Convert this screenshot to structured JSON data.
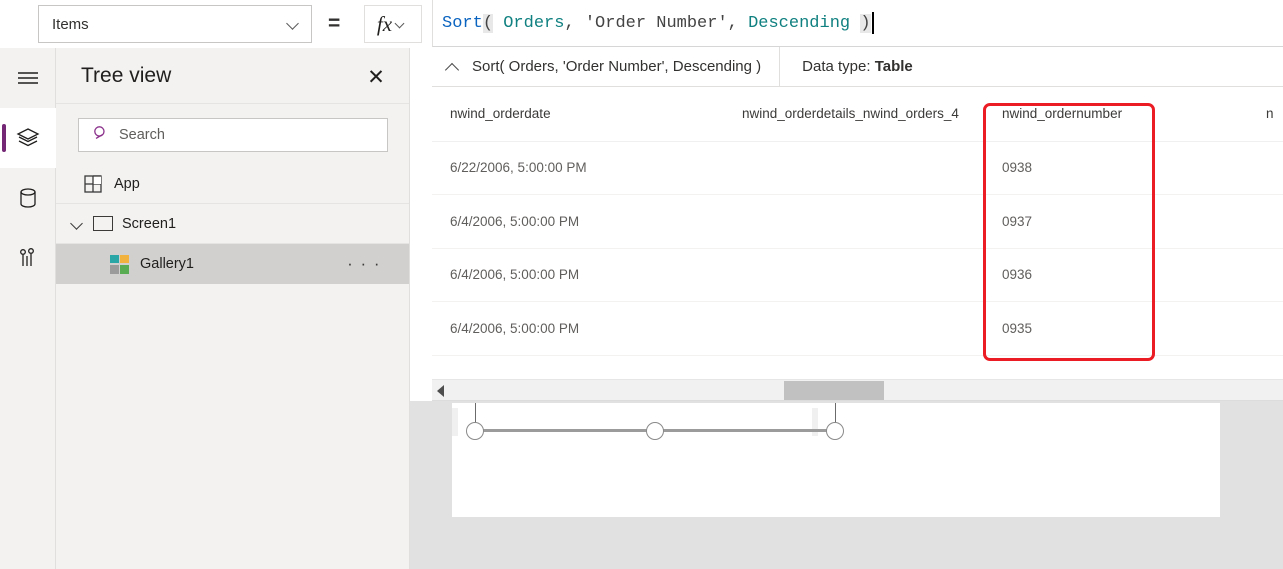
{
  "formula_strip": {
    "property_dropdown": {
      "value": "Items",
      "icon": "chevron-down-icon"
    },
    "equals_sign": "=",
    "fx_button": {
      "glyph": "fx",
      "icon": "chevron-down-icon"
    },
    "formula_tokens": [
      {
        "text": "Sort",
        "kind": "function"
      },
      {
        "text": "(",
        "kind": "paren"
      },
      {
        "text": " ",
        "kind": "plain"
      },
      {
        "text": "Orders",
        "kind": "identifier"
      },
      {
        "text": ", ",
        "kind": "plain"
      },
      {
        "text": "'Order Number'",
        "kind": "string"
      },
      {
        "text": ", ",
        "kind": "plain"
      },
      {
        "text": "Descending",
        "kind": "identifier"
      },
      {
        "text": " ",
        "kind": "plain"
      },
      {
        "text": ")",
        "kind": "paren"
      }
    ]
  },
  "result_bar": {
    "collapse_icon": "chevron-up-icon",
    "expression": "Sort( Orders, 'Order Number', Descending )",
    "data_type_label": "Data type: ",
    "data_type_value": "Table"
  },
  "data_table": {
    "columns": [
      "nwind_orderdate",
      "nwind_orderdetails_nwind_orders_4",
      "nwind_ordernumber",
      "n"
    ],
    "rows": [
      [
        "6/22/2006, 5:00:00 PM",
        "",
        "0938",
        ""
      ],
      [
        "6/4/2006, 5:00:00 PM",
        "",
        "0937",
        ""
      ],
      [
        "6/4/2006, 5:00:00 PM",
        "",
        "0936",
        ""
      ],
      [
        "6/4/2006, 5:00:00 PM",
        "",
        "0935",
        ""
      ]
    ],
    "highlight_color": "#ec1c24",
    "highlighted_column": "nwind_ordernumber"
  },
  "scrollbar": {
    "left_arrow_icon": "scroll-left-arrow-icon"
  },
  "rail": {
    "items": [
      {
        "icon": "hamburger-menu-icon",
        "active": false
      },
      {
        "icon": "layers-icon",
        "active": true
      },
      {
        "icon": "database-icon",
        "active": false
      },
      {
        "icon": "settings-sliders-icon",
        "active": false
      }
    ],
    "accent_color": "#742774"
  },
  "tree_view": {
    "title": "Tree view",
    "close_icon": "close-icon",
    "search": {
      "placeholder": "Search",
      "icon": "search-icon"
    },
    "items": [
      {
        "label": "App",
        "icon": "app-icon",
        "level": 0,
        "selected": false
      },
      {
        "label": "Screen1",
        "icon": "screen-icon",
        "level": 0,
        "selected": false,
        "expanded": true
      },
      {
        "label": "Gallery1",
        "icon": "gallery-icon",
        "level": 1,
        "selected": true,
        "overflow": "· · ·"
      }
    ],
    "gallery_icon_colors": [
      "#2aa6a6",
      "#f2b23e",
      "#9b9b9b",
      "#5aac52"
    ]
  }
}
